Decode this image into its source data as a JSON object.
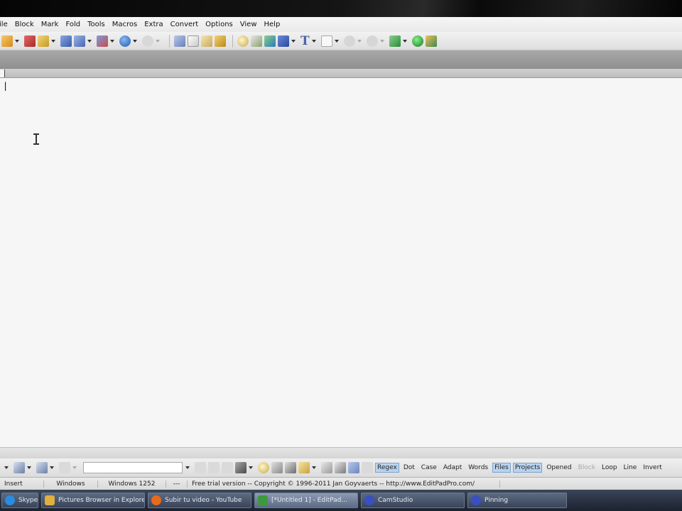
{
  "menu": [
    "File",
    "Block",
    "Mark",
    "Fold",
    "Tools",
    "Macros",
    "Extra",
    "Convert",
    "Options",
    "View",
    "Help"
  ],
  "editor": {
    "content": "|"
  },
  "search_options": [
    {
      "label": "Regex",
      "on": true
    },
    {
      "label": "Dot",
      "on": false
    },
    {
      "label": "Case",
      "on": false
    },
    {
      "label": "Adapt",
      "on": false
    },
    {
      "label": "Words",
      "on": false
    },
    {
      "label": "Files",
      "on": true
    },
    {
      "label": "Projects",
      "on": true
    },
    {
      "label": "Opened",
      "on": false
    },
    {
      "label": "Block",
      "on": false,
      "dim": true
    },
    {
      "label": "Loop",
      "on": false
    },
    {
      "label": "Line",
      "on": false
    },
    {
      "label": "Invert",
      "on": false
    }
  ],
  "status": {
    "mode": "Insert",
    "line_break": "Windows",
    "encoding": "Windows 1252",
    "blank": "---",
    "notice": "Free trial version -- Copyright © 1996-2011 Jan Goyvaerts -- http://www.EditPadPro.com/"
  },
  "taskbar": [
    {
      "label": "Skype™ - fernandoguia",
      "color": "#2a8be0"
    },
    {
      "label": "Pictures Browser in Explorer",
      "color": "#e0b040"
    },
    {
      "label": "Subir tu video - YouTube",
      "color": "#e86a1c"
    },
    {
      "label": "[*Untitled 1] - EditPad...",
      "color": "#3c9a3c",
      "active": true
    },
    {
      "label": "CamStudio",
      "color": "#3a4fc0"
    },
    {
      "label": "Pinning",
      "color": "#3a4fc0"
    }
  ]
}
